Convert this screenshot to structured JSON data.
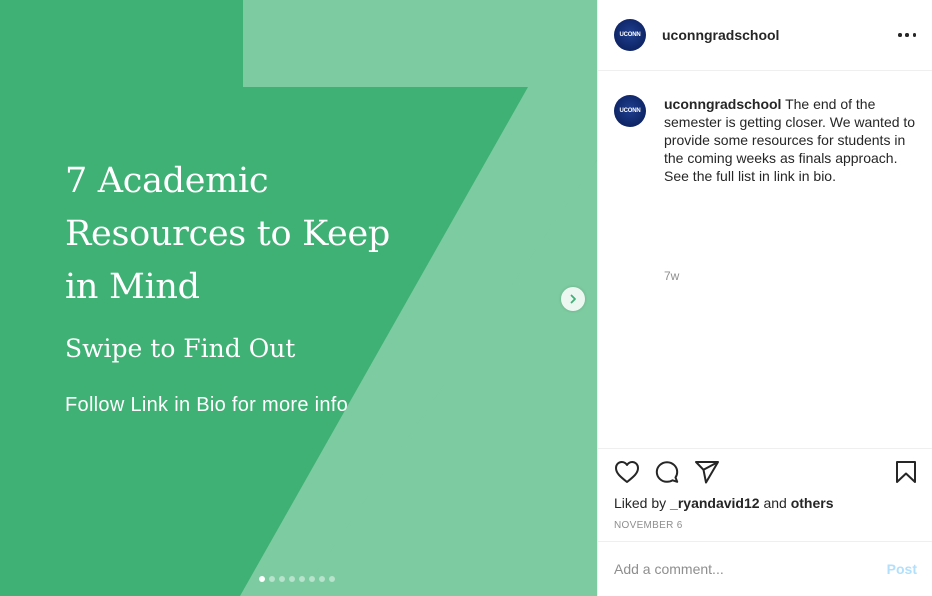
{
  "colors": {
    "slide_background": "#3fb174",
    "seven_shape": "#7dcba0",
    "avatar": "#0e2566",
    "post_button": "#b2dffc",
    "muted_text": "#8e8e8e"
  },
  "slide": {
    "title": "7 Academic Resources to Keep in Mind",
    "subtitle": "Swipe to Find Out",
    "note": "Follow Link in Bio for more info",
    "total_slides": 8,
    "active_slide": 1,
    "next_icon": "chevron-right-icon"
  },
  "header": {
    "avatar_text": "UCONN",
    "username": "uconngradschool",
    "more_icon": "more-horizontal-icon"
  },
  "caption": {
    "avatar_text": "UCONN",
    "username": "uconngradschool",
    "text": "The end of the semester is getting closer. We wanted to provide some resources for students in the coming weeks as finals approach. See the full list in link in bio.",
    "time_ago": "7w"
  },
  "actions": {
    "icons": [
      "heart-icon",
      "comment-icon",
      "share-icon",
      "bookmark-icon"
    ],
    "liked_by_prefix": "Liked by",
    "liked_by_user": "_ryandavid12",
    "liked_by_and": "and",
    "liked_by_others": "others",
    "date": "NOVEMBER 6"
  },
  "comment_box": {
    "placeholder": "Add a comment...",
    "post_label": "Post"
  }
}
